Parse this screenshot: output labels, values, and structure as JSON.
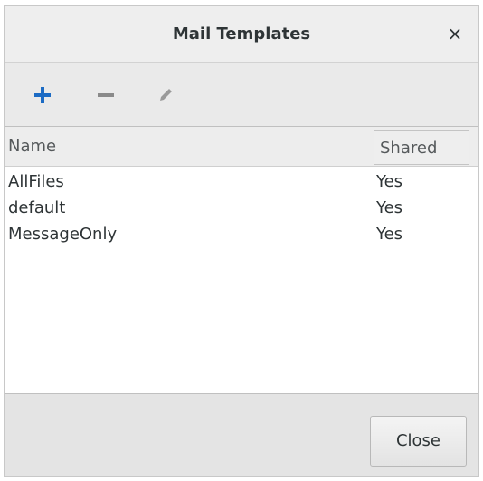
{
  "window": {
    "title": "Mail Templates",
    "close_glyph": "×"
  },
  "toolbar": {
    "add_icon": "plus-icon",
    "remove_icon": "minus-icon",
    "edit_icon": "pencil-icon",
    "accent_color": "#1c6bc4"
  },
  "table": {
    "columns": [
      "Name",
      "Shared"
    ],
    "rows": [
      {
        "name": "AllFiles",
        "shared": "Yes"
      },
      {
        "name": "default",
        "shared": "Yes"
      },
      {
        "name": "MessageOnly",
        "shared": "Yes"
      }
    ]
  },
  "footer": {
    "close_label": "Close"
  }
}
